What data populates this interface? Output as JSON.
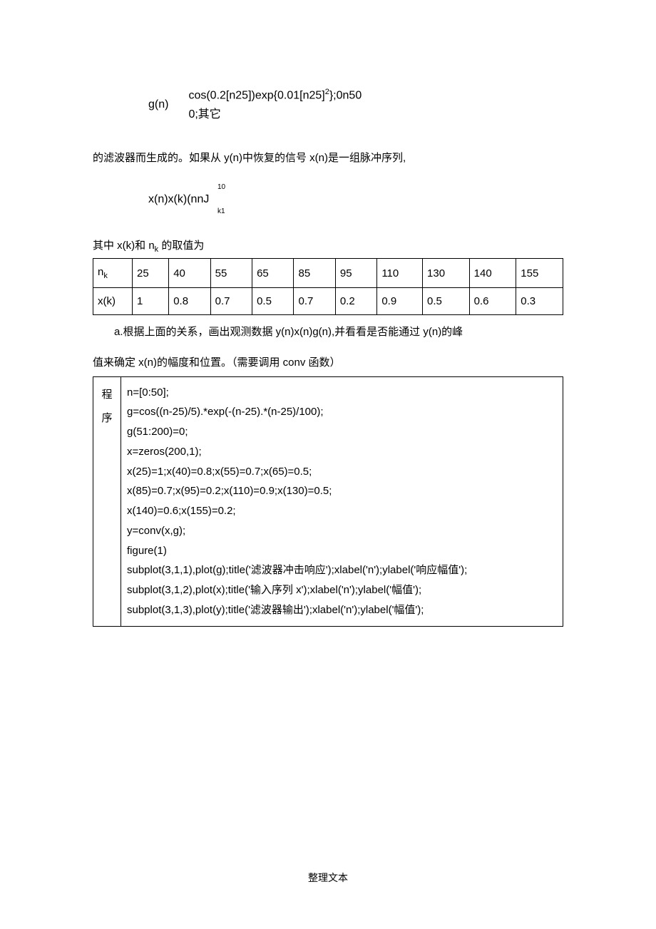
{
  "formula1": {
    "left": "g(n)",
    "line1": "cos(0.2[n25])exp{0.01[n25]",
    "line1_sup": "2",
    "line1_tail": "};0n50",
    "line2": "0;其它"
  },
  "para1": "的滤波器而生成的。如果从 y(n)中恢复的信号 x(n)是一组脉冲序列,",
  "formula2": {
    "top": "10",
    "main": "x(n)x(k)(nnJ",
    "bot": "k1"
  },
  "subline_prefix": "其中 x(k)和 n",
  "subline_sub": "k",
  "subline_suffix": " 的取值为",
  "table": {
    "row1_label": "n",
    "row1_label_sub": "k",
    "row1": [
      "25",
      "40",
      "55",
      "65",
      "85",
      "95",
      "110",
      "130",
      "140",
      "155"
    ],
    "row2_label": "x(k)",
    "row2": [
      "1",
      "0.8",
      "0.7",
      "0.5",
      "0.7",
      "0.2",
      "0.9",
      "0.5",
      "0.6",
      "0.3"
    ]
  },
  "indent1": "a.根据上面的关系，画出观测数据 y(n)x(n)g(n),并看看是否能通过 y(n)的峰",
  "indent2": "值来确定 x(n)的幅度和位置。（需要调用 conv 函数）",
  "code": {
    "left_top": "程",
    "left_bot": "序",
    "lines": [
      "n=[0:50];",
      "g=cos((n-25)/5).*exp(-(n-25).*(n-25)/100);",
      "g(51:200)=0;",
      "x=zeros(200,1);",
      "x(25)=1;x(40)=0.8;x(55)=0.7;x(65)=0.5;",
      "x(85)=0.7;x(95)=0.2;x(110)=0.9;x(130)=0.5;",
      "x(140)=0.6;x(155)=0.2;",
      "y=conv(x,g);",
      "figure(1)",
      "subplot(3,1,1),plot(g);title('滤波器冲击响应');xlabel('n');ylabel('响应幅值');",
      "subplot(3,1,2),plot(x);title('输入序列 x');xlabel('n');ylabel('幅值');",
      "subplot(3,1,3),plot(y);title('滤波器输出');xlabel('n');ylabel('幅值');"
    ]
  },
  "footer": "整理文本"
}
